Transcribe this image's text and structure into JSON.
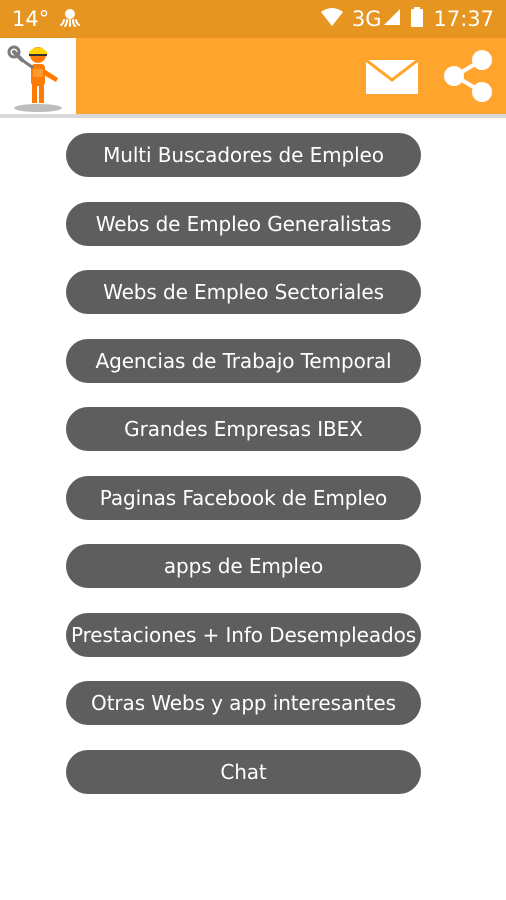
{
  "status_bar": {
    "temperature": "14°",
    "network": "3G",
    "time": "17:37",
    "icons": [
      "weather-icon",
      "octopus-notification-icon",
      "wifi-icon",
      "signal-icon",
      "battery-icon"
    ]
  },
  "app_bar": {
    "colors": {
      "primary": "#ffa52e",
      "status": "#e69520",
      "button": "#5e5e5e"
    },
    "icons": [
      "mail-icon",
      "share-icon"
    ]
  },
  "menu": {
    "items": [
      {
        "label": "Multi Buscadores de Empleo"
      },
      {
        "label": "Webs de Empleo Generalistas"
      },
      {
        "label": "Webs de Empleo Sectoriales"
      },
      {
        "label": "Agencias de Trabajo Temporal"
      },
      {
        "label": "Grandes Empresas IBEX"
      },
      {
        "label": "Paginas Facebook de Empleo"
      },
      {
        "label": "apps de Empleo"
      },
      {
        "label": "Prestaciones + Info Desempleados"
      },
      {
        "label": "Otras Webs y app interesantes"
      },
      {
        "label": "Chat"
      }
    ]
  }
}
